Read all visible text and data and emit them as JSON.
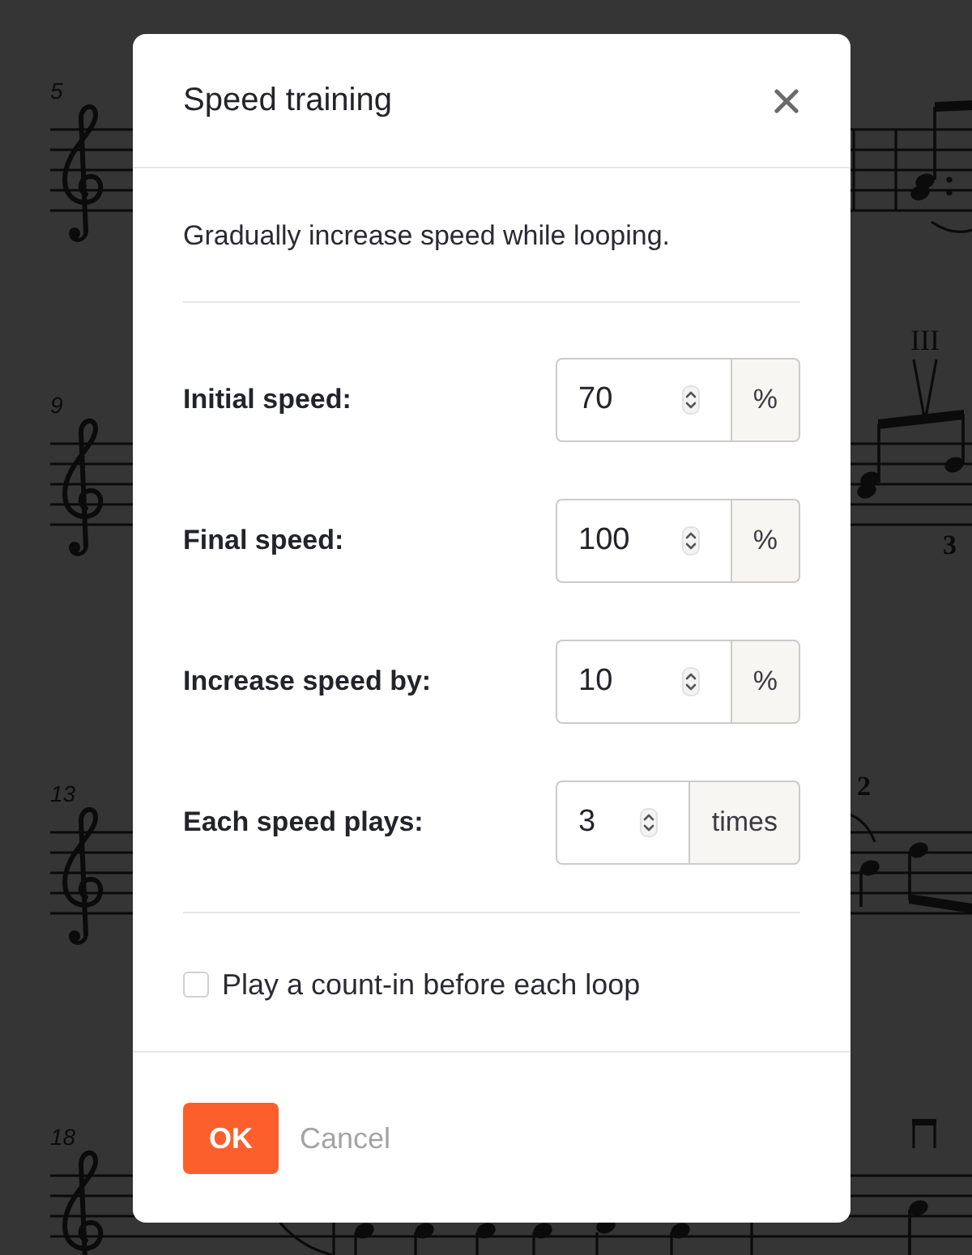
{
  "score": {
    "systems": [
      {
        "measure_number": "5"
      },
      {
        "measure_number": "9",
        "markings": [
          {
            "text": "III",
            "kind": "string_number"
          },
          {
            "text": "3",
            "kind": "fingering_below"
          }
        ]
      },
      {
        "measure_number": "13",
        "markings": [
          {
            "text": "2",
            "kind": "fingering_above"
          }
        ]
      },
      {
        "measure_number": "18"
      }
    ]
  },
  "dialog": {
    "title": "Speed training",
    "description": "Gradually increase speed while looping.",
    "fields": [
      {
        "label": "Initial speed:",
        "value": "70",
        "unit": "%"
      },
      {
        "label": "Final speed:",
        "value": "100",
        "unit": "%"
      },
      {
        "label": "Increase speed by:",
        "value": "10",
        "unit": "%"
      },
      {
        "label": "Each speed plays:",
        "value": "3",
        "unit": "times"
      }
    ],
    "checkbox": {
      "label": "Play a count-in before each loop",
      "checked": false
    },
    "buttons": [
      {
        "label": "OK",
        "kind": "primary"
      },
      {
        "label": "Cancel",
        "kind": "secondary"
      }
    ]
  }
}
